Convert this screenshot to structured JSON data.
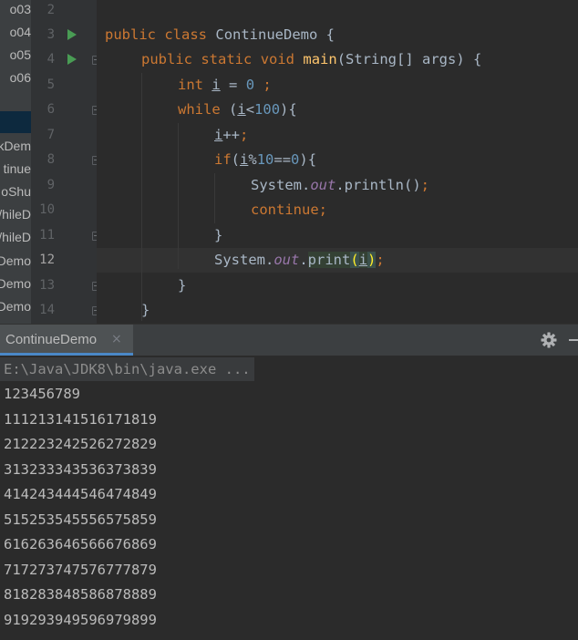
{
  "project_tree": {
    "items": [
      "o03",
      "o04",
      "o05",
      "o06",
      "kDem",
      "tinue",
      "oShu",
      "/hileD",
      "/hileD",
      "Demo",
      "Demo",
      "Demo"
    ]
  },
  "gutter": {
    "line_numbers": [
      "2",
      "3",
      "4",
      "5",
      "6",
      "7",
      "8",
      "9",
      "10",
      "11",
      "12",
      "13",
      "14"
    ],
    "active_line": "12"
  },
  "code": {
    "l3": {
      "kw1": "public",
      "kw2": "class",
      "name": "ContinueDemo",
      "brace": " {"
    },
    "l4": {
      "kw1": "public",
      "kw2": "static",
      "kw3": "void",
      "method": "main",
      "params": "(String[] args) {"
    },
    "l5": {
      "kw": "int",
      "var": "i",
      "eq": " = ",
      "num": "0",
      "semi": " ;"
    },
    "l6": {
      "kw": "while",
      "open": " (",
      "var": "i",
      "op": "<",
      "num": "100",
      "close": "){"
    },
    "l7": {
      "var": "i",
      "rest": "++",
      "semi": ";"
    },
    "l8": {
      "kw": "if",
      "open": "(",
      "var": "i",
      "op": "%",
      "num1": "10",
      "eq": "==",
      "num2": "0",
      "close": "){"
    },
    "l9": {
      "cls": "System.",
      "field": "out",
      "call": ".println()",
      "semi": ";"
    },
    "l10": {
      "kw": "continue",
      "semi": ";"
    },
    "l11": {
      "brace": "}"
    },
    "l12": {
      "cls": "System.",
      "field": "out",
      "dot": ".",
      "call": "print",
      "lp": "(",
      "var": "i",
      "rp": ")",
      "semi": ";"
    },
    "l13": {
      "brace": "}"
    },
    "l14": {
      "brace": "}"
    }
  },
  "run_panel": {
    "tab_label": "ContinueDemo",
    "close_glyph": "×",
    "command": "E:\\Java\\JDK8\\bin\\java.exe ...",
    "output": [
      "123456789",
      "111213141516171819",
      "212223242526272829",
      "313233343536373839",
      "414243444546474849",
      "515253545556575859",
      "616263646566676869",
      "717273747576777879",
      "818283848586878889",
      "919293949596979899"
    ]
  },
  "icons": {
    "run": "run-gutter-icon",
    "fold": "fold-marker-icon",
    "settings": "gear-icon",
    "hide": "minimize-icon"
  },
  "colors": {
    "keyword": "#cc7832",
    "method": "#ffc66d",
    "number": "#6897bb",
    "field": "#9876aa",
    "run": "#499c54"
  }
}
